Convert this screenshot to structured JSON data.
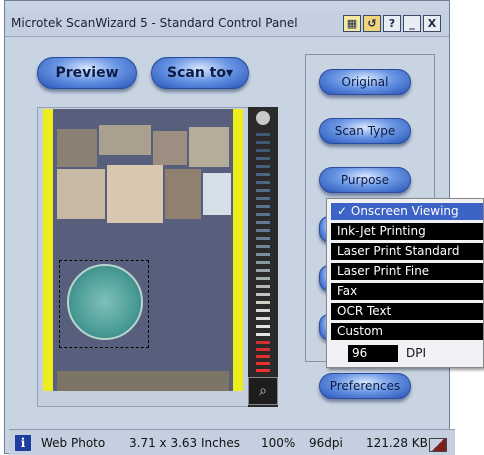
{
  "window": {
    "title": "Microtek ScanWizard 5 - Standard Control Panel",
    "titlebar_buttons": [
      "?",
      "_",
      "X"
    ]
  },
  "toolbar": {
    "preview_label": "Preview",
    "scan_to_label": "Scan to▾"
  },
  "right_panel": {
    "original_label": "Original",
    "scan_type_label": "Scan Type",
    "purpose_label": "Purpose",
    "preferences_label": "Preferences"
  },
  "purpose_menu": {
    "items": [
      "✓ Onscreen Viewing",
      "Ink-Jet Printing",
      "Laser Print Standard",
      "Laser Print Fine",
      "Fax",
      "OCR Text",
      "Custom"
    ],
    "dpi_value": "96",
    "dpi_label": "DPI"
  },
  "statusbar": {
    "info_glyph": "i",
    "image_type": "Web Photo",
    "dimensions": "3.71 x 3.63 Inches",
    "scale": "100%",
    "resolution": "96dpi",
    "file_size": "121.28 KB"
  },
  "colors": {
    "accent_blue": "#3d63c6",
    "panel_bg": "#c9d4e2",
    "frame_yellow": "#eded1c"
  }
}
